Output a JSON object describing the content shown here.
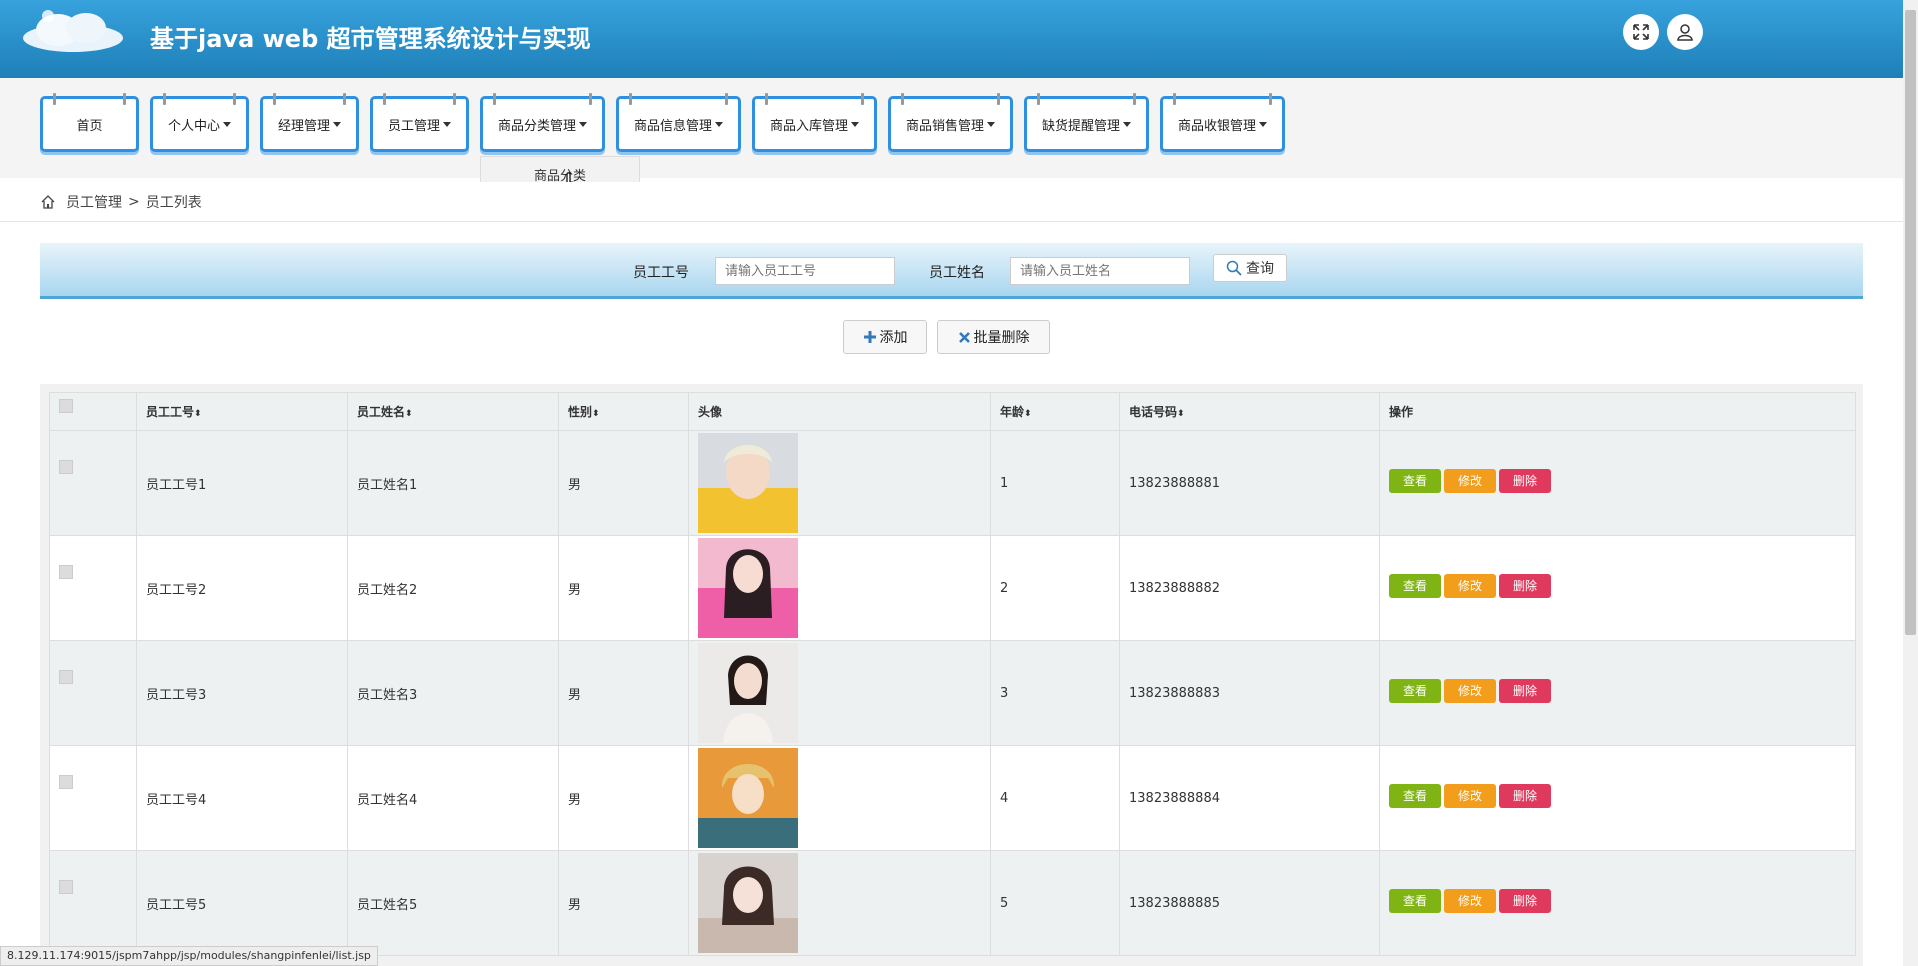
{
  "app": {
    "title": "基于java web 超市管理系统设计与实现"
  },
  "nav": {
    "items": [
      {
        "label": "首页"
      },
      {
        "label": "个人中心"
      },
      {
        "label": "经理管理"
      },
      {
        "label": "员工管理"
      },
      {
        "label": "商品分类管理"
      },
      {
        "label": "商品信息管理"
      },
      {
        "label": "商品入库管理"
      },
      {
        "label": "商品销售管理"
      },
      {
        "label": "缺货提醒管理"
      },
      {
        "label": "商品收银管理"
      }
    ],
    "dropdown_item": "商品分类"
  },
  "breadcrumb": {
    "section": "员工管理",
    "separator": ">",
    "page": "员工列表"
  },
  "search": {
    "field1_label": "员工工号",
    "field1_placeholder": "请输入员工工号",
    "field2_label": "员工姓名",
    "field2_placeholder": "请输入员工姓名",
    "button": "查询"
  },
  "actions": {
    "add": "添加",
    "batch_delete": "批量删除"
  },
  "table": {
    "headers": {
      "id": "员工工号",
      "name": "员工姓名",
      "gender": "性别",
      "avatar": "头像",
      "age": "年龄",
      "phone": "电话号码",
      "ops": "操作"
    },
    "sort_glyph": "⬍",
    "rows": [
      {
        "id": "员工工号1",
        "name": "员工姓名1",
        "gender": "男",
        "age": "1",
        "phone": "13823888881"
      },
      {
        "id": "员工工号2",
        "name": "员工姓名2",
        "gender": "男",
        "age": "2",
        "phone": "13823888882"
      },
      {
        "id": "员工工号3",
        "name": "员工姓名3",
        "gender": "男",
        "age": "3",
        "phone": "13823888883"
      },
      {
        "id": "员工工号4",
        "name": "员工姓名4",
        "gender": "男",
        "age": "4",
        "phone": "13823888884"
      },
      {
        "id": "员工工号5",
        "name": "员工姓名5",
        "gender": "男",
        "age": "5",
        "phone": "13823888885"
      }
    ],
    "op_labels": {
      "view": "查看",
      "edit": "修改",
      "delete": "删除"
    }
  },
  "status_bar": {
    "url": "8.129.11.174:9015/jspm7ahpp/jsp/modules/shangpinfenlei/list.jsp"
  },
  "colors": {
    "header": "#1e7fb8",
    "nav_border": "#2f8fe0",
    "view": "#7fb414",
    "edit": "#f29d1b",
    "delete": "#e0395e"
  },
  "icons": [
    "cloud-logo-icon",
    "fullscreen-icon",
    "user-icon",
    "home-icon",
    "search-icon",
    "plus-icon",
    "close-icon",
    "cursor-icon"
  ]
}
